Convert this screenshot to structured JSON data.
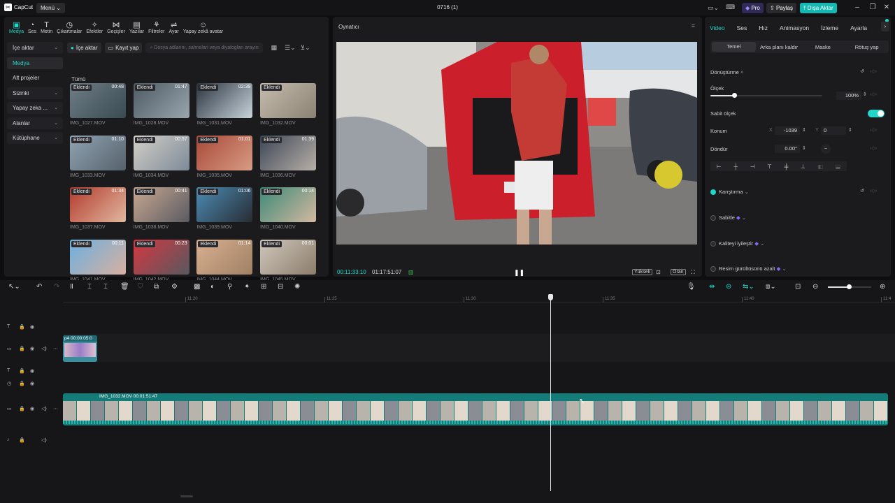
{
  "app": {
    "logo_text": "CapCut",
    "menu_label": "Menü",
    "project_title": "0716 (1)",
    "pro_label": "Pro",
    "share_label": "Paylaş",
    "export_label": "Dışa Aktar"
  },
  "tools": [
    {
      "label": "Medya",
      "icon": "▣"
    },
    {
      "label": "Ses",
      "icon": "◔"
    },
    {
      "label": "Metin",
      "icon": "T"
    },
    {
      "label": "Çıkartmalar",
      "icon": "◷"
    },
    {
      "label": "Efektler",
      "icon": "✧"
    },
    {
      "label": "Geçişler",
      "icon": "⋈"
    },
    {
      "label": "Yazılar",
      "icon": "▤"
    },
    {
      "label": "Filtreler",
      "icon": "⚘"
    },
    {
      "label": "Ayar",
      "icon": "⇌"
    },
    {
      "label": "Yapay zekâ avatar",
      "icon": "☺"
    }
  ],
  "sidebar": [
    {
      "label": "İçe aktar",
      "active": false,
      "group": true
    },
    {
      "label": "Medya",
      "active": true,
      "group": false
    },
    {
      "label": "Alt projeler",
      "active": false,
      "group": false
    },
    {
      "label": "Sizinki",
      "active": false,
      "group": true
    },
    {
      "label": "Yapay zeka ...",
      "active": false,
      "group": true
    },
    {
      "label": "Alanlar",
      "active": false,
      "group": true
    },
    {
      "label": "Kütüphane",
      "active": false,
      "group": true
    }
  ],
  "media_bar": {
    "import_label": "İçe aktar",
    "record_label": "Kayıt yap",
    "search_placeholder": "Dosya adlarını, sahnelari veya diyalogları arayın"
  },
  "media_section_title": "Tümü",
  "media_items": [
    {
      "name": "IMG_1027.MOV",
      "badge": "Eklendi",
      "duration": "00:48",
      "c1": "#6f7e86",
      "c2": "#3a4a52"
    },
    {
      "name": "IMG_1028.MOV",
      "badge": "Eklendi",
      "duration": "01:47",
      "c1": "#4c5a64",
      "c2": "#9aa6ae"
    },
    {
      "name": "IMG_1031.MOV",
      "badge": "Eklendi",
      "duration": "02:39",
      "c1": "#2a3440",
      "c2": "#c8d4dc"
    },
    {
      "name": "IMG_1032.MOV",
      "badge": "Eklendi",
      "duration": "",
      "c1": "#c6bcae",
      "c2": "#8c8274"
    },
    {
      "name": "IMG_1033.MOV",
      "badge": "Eklendi",
      "duration": "01:10",
      "c1": "#8fa4b4",
      "c2": "#56616a"
    },
    {
      "name": "IMG_1034.MOV",
      "badge": "Eklendi",
      "duration": "00:57",
      "c1": "#d4d0c8",
      "c2": "#7c8a98"
    },
    {
      "name": "IMG_1035.MOV",
      "badge": "Eklendi",
      "duration": "01:01",
      "c1": "#a84838",
      "c2": "#d89c84"
    },
    {
      "name": "IMG_1036.MOV",
      "badge": "Eklendi",
      "duration": "01:39",
      "c1": "#3c4656",
      "c2": "#b8b0a8"
    },
    {
      "name": "IMG_1037.MOV",
      "badge": "Eklendi",
      "duration": "01:34",
      "c1": "#b43a2c",
      "c2": "#e0b8a0"
    },
    {
      "name": "IMG_1038.MOV",
      "badge": "Eklendi",
      "duration": "00:41",
      "c1": "#c8a890",
      "c2": "#5a5a62"
    },
    {
      "name": "IMG_1039.MOV",
      "badge": "Eklendi",
      "duration": "01:06",
      "c1": "#4c8cb4",
      "c2": "#282c34"
    },
    {
      "name": "IMG_1040.MOV",
      "badge": "Eklendi",
      "duration": "00:14",
      "c1": "#3c8a78",
      "c2": "#d4b8a0"
    },
    {
      "name": "IMG_1041.MOV",
      "badge": "Eklendi",
      "duration": "00:11",
      "c1": "#6cb0e0",
      "c2": "#d8b0a0"
    },
    {
      "name": "IMG_1042.MOV",
      "badge": "Eklendi",
      "duration": "00:23",
      "c1": "#d43840",
      "c2": "#585860"
    },
    {
      "name": "IMG_1044.MOV",
      "badge": "Eklendi",
      "duration": "01:14",
      "c1": "#d8b090",
      "c2": "#a08064"
    },
    {
      "name": "IMG_1045.MOV",
      "badge": "Eklendi",
      "duration": "00:01",
      "c1": "#cfc8bc",
      "c2": "#8c7c6c"
    }
  ],
  "player": {
    "title": "Oynatıcı",
    "current_time": "00:11:33:10",
    "total_time": "01:17:51:07",
    "quality_label": "Yüksek",
    "ratio_label": "Oran"
  },
  "inspector": {
    "tabs": [
      {
        "label": "Video",
        "active": true
      },
      {
        "label": "Ses",
        "active": false
      },
      {
        "label": "Hız",
        "active": false
      },
      {
        "label": "Animasyon",
        "active": false
      },
      {
        "label": "İzleme",
        "active": false
      },
      {
        "label": "Ayarla",
        "active": false
      }
    ],
    "subtabs": [
      {
        "label": "Temel",
        "active": true
      },
      {
        "label": "Arka planı kaldır",
        "active": false
      },
      {
        "label": "Maske",
        "active": false
      },
      {
        "label": "Rötuş yap",
        "active": false
      }
    ],
    "transform_label": "Dönüştürme",
    "scale_label": "Ölçek",
    "scale_value": "100%",
    "scale_fraction": 0.07,
    "uniform_scale_label": "Sabit ölçek",
    "position_label": "Konum",
    "pos_x_label": "X",
    "pos_x": "-1039",
    "pos_y_label": "Y",
    "pos_y": "0",
    "rotate_label": "Döndür",
    "rotate_value": "0.00°",
    "rotate_dash": "–",
    "blend_label": "Karıştırma",
    "stabilize_label": "Sabitle",
    "enhance_label": "Kaliteyi iyileştir",
    "denoise_label": "Resim gürültüsünü azalt"
  },
  "timeline": {
    "ruler": [
      "11:20",
      "11:25",
      "11:30",
      "11:35",
      "11:40",
      "11:4"
    ],
    "small_clip_label": "p4  00:00:05:0",
    "main_clip_label": "IMG_1032.MOV  00:01:51:47"
  },
  "colors": {
    "accent": "#1fd6c9",
    "export": "#14b8b0",
    "pro": "#5b48d6",
    "clip_teal": "#137c78",
    "playhead": "#e6e6e6"
  }
}
